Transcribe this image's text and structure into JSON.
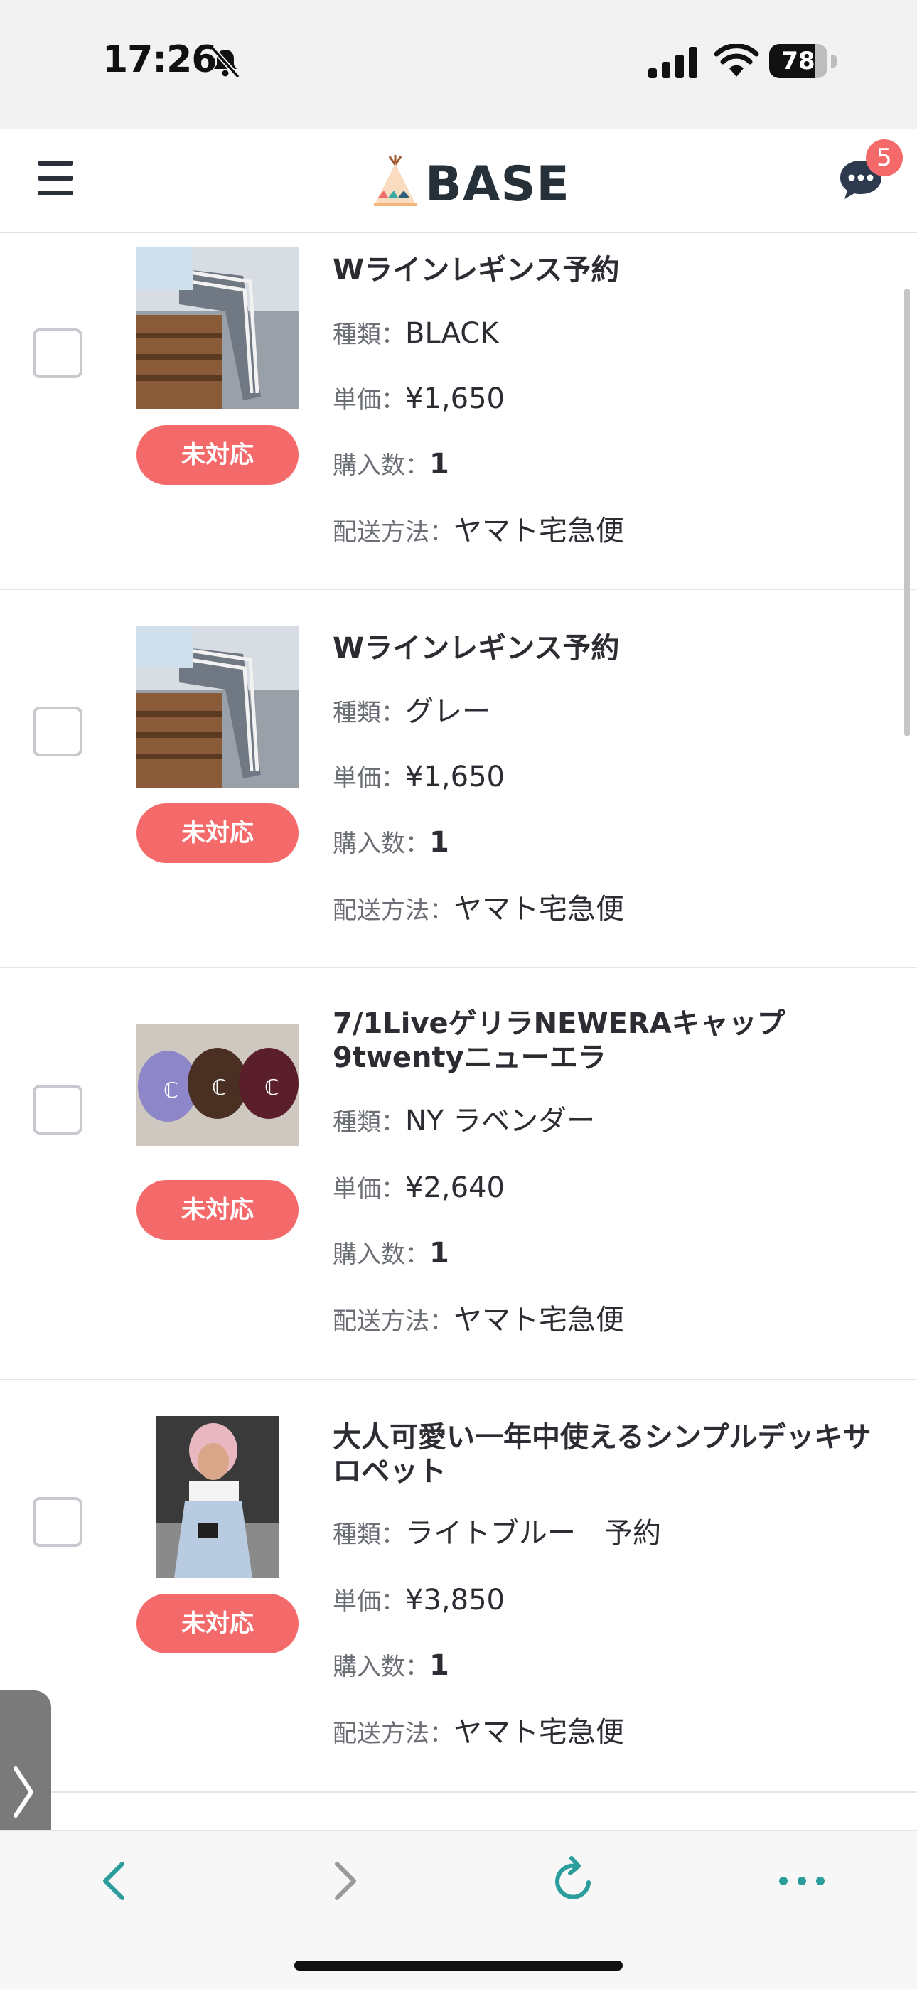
{
  "status_bar": {
    "time": "17:26",
    "battery": "78",
    "battery_level": 0.78,
    "icons": [
      "bell-slash-icon",
      "signal-icon",
      "wifi-icon",
      "battery-icon"
    ]
  },
  "header": {
    "logo_text": "BASE",
    "chat_badge": "5",
    "icons": [
      "menu-icon",
      "base-logo-tent-icon",
      "chat-bubble-icon"
    ]
  },
  "colors": {
    "accent": "#f46a6a",
    "text": "#2b2d33",
    "label": "#6b6e75",
    "nav_teal": "#2a9d9c"
  },
  "labels": {
    "variant": "種類：",
    "price": "単価：",
    "qty": "購入数：",
    "shipping": "配送方法："
  },
  "items": [
    {
      "title": "Wラインレギンス予約",
      "status": "未対応",
      "variant": "BLACK",
      "price": "¥1,650",
      "qty": "1",
      "shipping": "ヤマト宅急便",
      "image": "leggings-photo"
    },
    {
      "title": "Wラインレギンス予約",
      "status": "未対応",
      "variant": "グレー",
      "price": "¥1,650",
      "qty": "1",
      "shipping": "ヤマト宅急便",
      "image": "leggings-photo"
    },
    {
      "title": "7/1LiveゲリラNEWERAキャップ9twentyニューエラ",
      "status": "未対応",
      "variant": "NY ラベンダー",
      "price": "¥2,640",
      "qty": "1",
      "shipping": "ヤマト宅急便",
      "image": "caps-photo"
    },
    {
      "title": "大人可愛い一年中使えるシンプルデッキサロペット",
      "status": "未対応",
      "variant": "ライトブルー　予約",
      "price": "¥3,850",
      "qty": "1",
      "shipping": "ヤマト宅急便",
      "image": "overalls-photo"
    }
  ],
  "browser_bar": {
    "icons": [
      "back-arrow-icon",
      "forward-arrow-icon",
      "reload-icon",
      "more-icon"
    ]
  }
}
